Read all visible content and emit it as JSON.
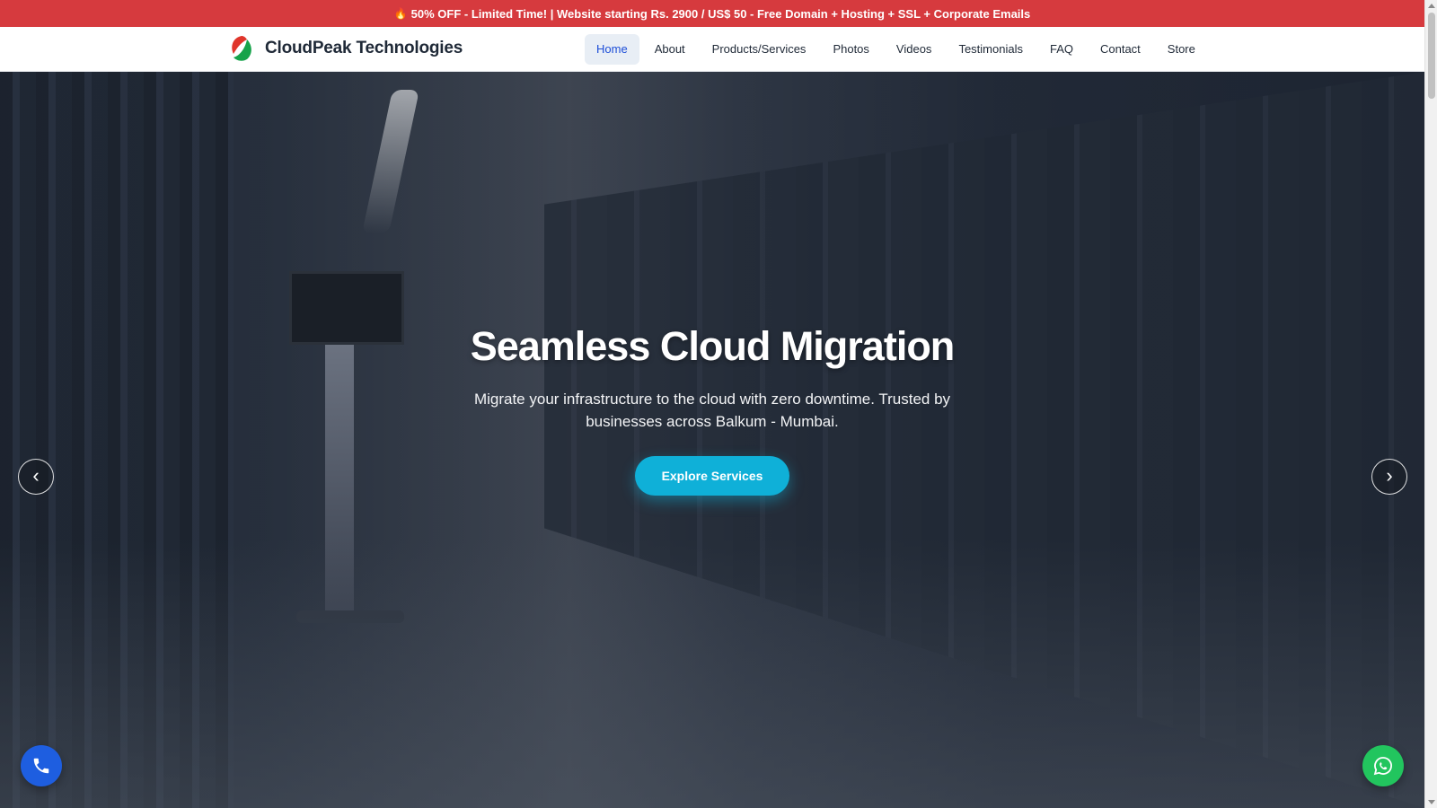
{
  "promo": {
    "icon": "fire-icon",
    "text": "50% OFF - Limited Time! | Website starting Rs. 2900 / US$ 50 - Free Domain + Hosting + SSL + Corporate Emails"
  },
  "brand": {
    "name": "CloudPeak Technologies",
    "logo_colors": [
      "#e0352b",
      "#16a34a"
    ]
  },
  "nav": {
    "items": [
      {
        "label": "Home",
        "active": true
      },
      {
        "label": "About"
      },
      {
        "label": "Products/Services"
      },
      {
        "label": "Photos"
      },
      {
        "label": "Videos"
      },
      {
        "label": "Testimonials"
      },
      {
        "label": "FAQ"
      },
      {
        "label": "Contact"
      },
      {
        "label": "Store"
      }
    ]
  },
  "hero": {
    "title": "Seamless Cloud Migration",
    "subtitle": "Migrate your infrastructure to the cloud with zero downtime. Trusted by businesses across Balkum - Mumbai.",
    "cta_label": "Explore Services",
    "prev_label": "‹",
    "next_label": "›"
  },
  "floating": {
    "call_icon": "phone-icon",
    "whatsapp_icon": "whatsapp-icon"
  },
  "colors": {
    "promo_bg": "#d63a3e",
    "accent": "#0fb0d8",
    "call": "#1e5ee0",
    "whatsapp": "#22c55e"
  }
}
